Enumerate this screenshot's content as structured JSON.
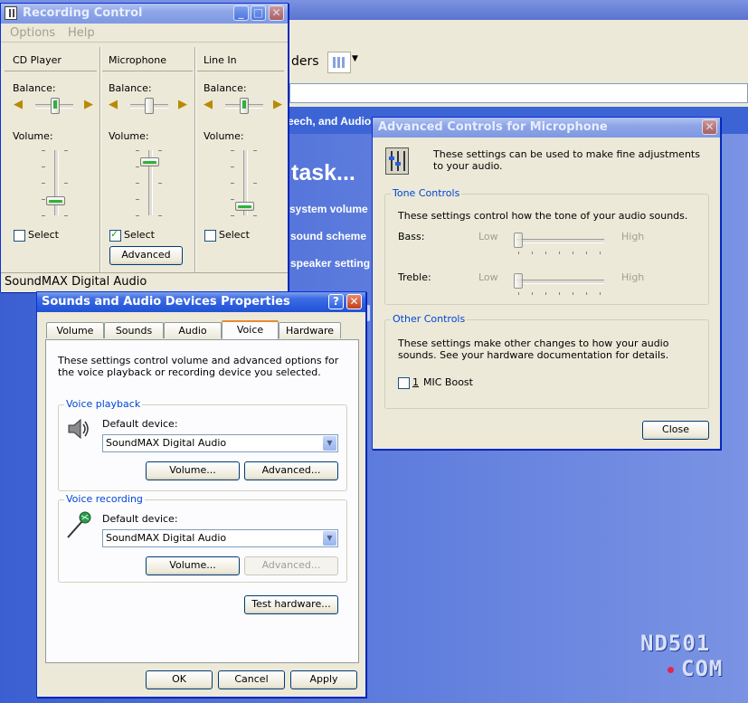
{
  "background": {
    "toolbar_text_partial": "ders",
    "side_links": [
      "eech, and Audio",
      "system volume",
      "sound scheme",
      "speaker setting"
    ],
    "heading_partial": "task..."
  },
  "recording_control": {
    "title": "Recording Control",
    "menu": [
      "Options",
      "Help"
    ],
    "channels": [
      {
        "name": "CD Player",
        "balance_label": "Balance:",
        "volume_label": "Volume:",
        "select_label": "Select",
        "selected": false,
        "volume_level": 0.3
      },
      {
        "name": "Microphone",
        "balance_label": "Balance:",
        "volume_label": "Volume:",
        "select_label": "Select",
        "selected": true,
        "volume_level": 0.85,
        "advanced_label": "Advanced"
      },
      {
        "name": "Line In",
        "balance_label": "Balance:",
        "volume_label": "Volume:",
        "select_label": "Select",
        "selected": false,
        "volume_level": 0.2
      }
    ],
    "status": "SoundMAX Digital Audio"
  },
  "advanced_controls": {
    "title": "Advanced Controls for Microphone",
    "intro": "These settings can be used to make fine adjustments to your audio.",
    "tone_group": "Tone Controls",
    "tone_desc": "These settings control how the tone of your audio sounds.",
    "bass_label": "Bass:",
    "treble_label": "Treble:",
    "low": "Low",
    "high": "High",
    "other_group": "Other Controls",
    "other_desc": "These settings make other changes to how your audio sounds.  See your hardware documentation for details.",
    "mic_boost_number": "1",
    "mic_boost_label": "MIC Boost",
    "close_label": "Close"
  },
  "sounds_dialog": {
    "title": "Sounds and Audio Devices Properties",
    "tabs": [
      "Volume",
      "Sounds",
      "Audio",
      "Voice",
      "Hardware"
    ],
    "active_tab": "Voice",
    "intro": "These settings control volume and advanced options for the voice playback or recording device you selected.",
    "playback_group": "Voice playback",
    "playback_default_label": "Default device:",
    "playback_device": "SoundMAX Digital Audio",
    "playback_volume_btn": "Volume...",
    "playback_advanced_btn": "Advanced...",
    "recording_group": "Voice recording",
    "recording_default_label": "Default device:",
    "recording_device": "SoundMAX Digital Audio",
    "recording_volume_btn": "Volume...",
    "recording_advanced_btn": "Advanced...",
    "test_btn": "Test hardware...",
    "ok": "OK",
    "cancel": "Cancel",
    "apply": "Apply"
  },
  "watermark": {
    "line1": "ND501",
    "line2": "COM"
  }
}
